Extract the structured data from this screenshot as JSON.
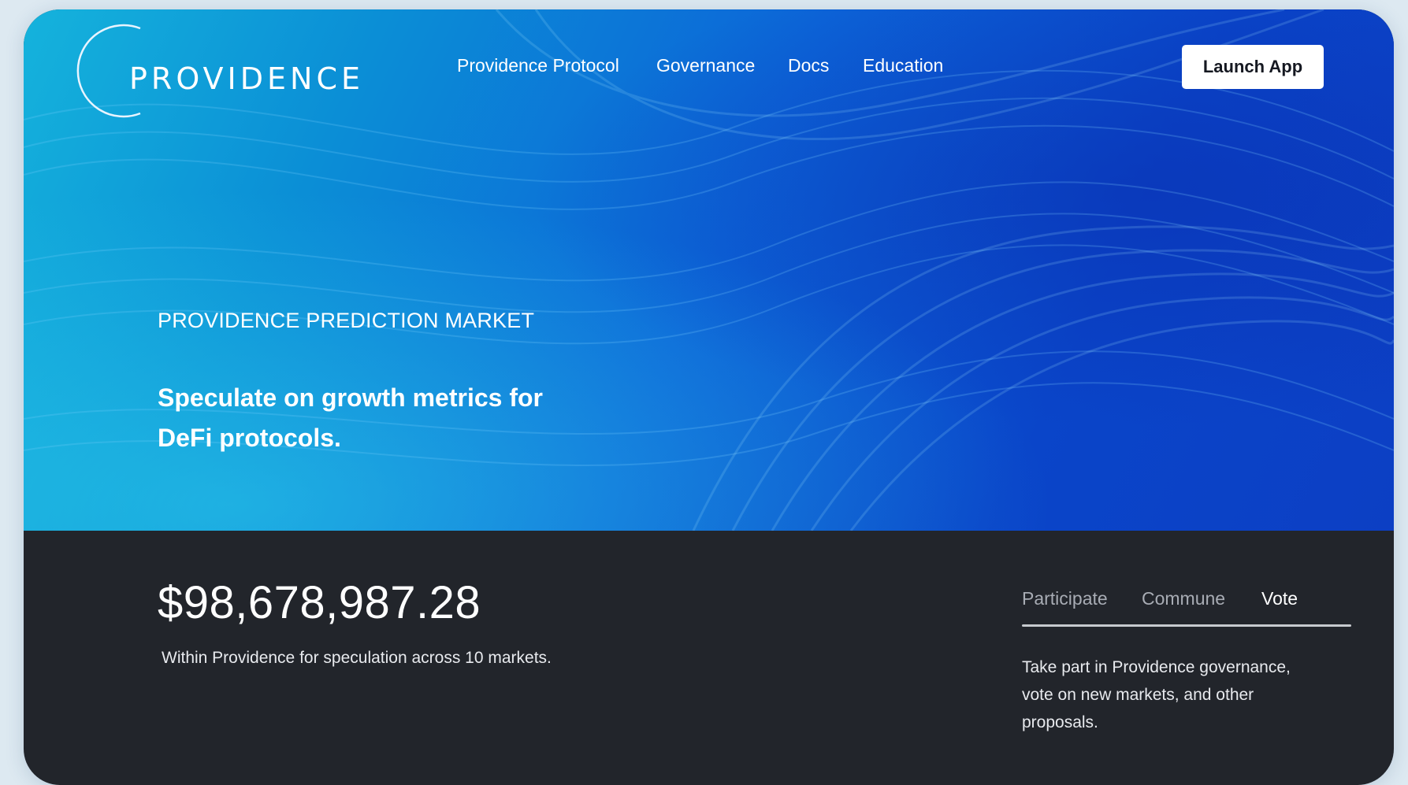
{
  "brand": {
    "name": "PROVIDENCE"
  },
  "nav": {
    "items": [
      {
        "label": "Providence Protocol"
      },
      {
        "label": "Governance"
      },
      {
        "label": "Docs"
      },
      {
        "label": "Education"
      }
    ],
    "launch_label": "Launch App"
  },
  "hero": {
    "eyebrow": "PROVIDENCE PREDICTION MARKET",
    "headline": "Speculate on growth metrics for DeFi protocols."
  },
  "stats": {
    "value": "$98,678,987.28",
    "caption": "Within Providence for speculation across 10 markets."
  },
  "tabs": {
    "items": [
      {
        "label": "Participate",
        "active": false
      },
      {
        "label": "Commune",
        "active": false
      },
      {
        "label": "Vote",
        "active": true
      }
    ],
    "description": "Take part in Providence governance, vote on new markets, and other proposals."
  },
  "colors": {
    "hero_light": "#15b3dc",
    "hero_dark": "#0c3fc4",
    "footer_bg": "#22252b",
    "button_bg": "#ffffff"
  }
}
